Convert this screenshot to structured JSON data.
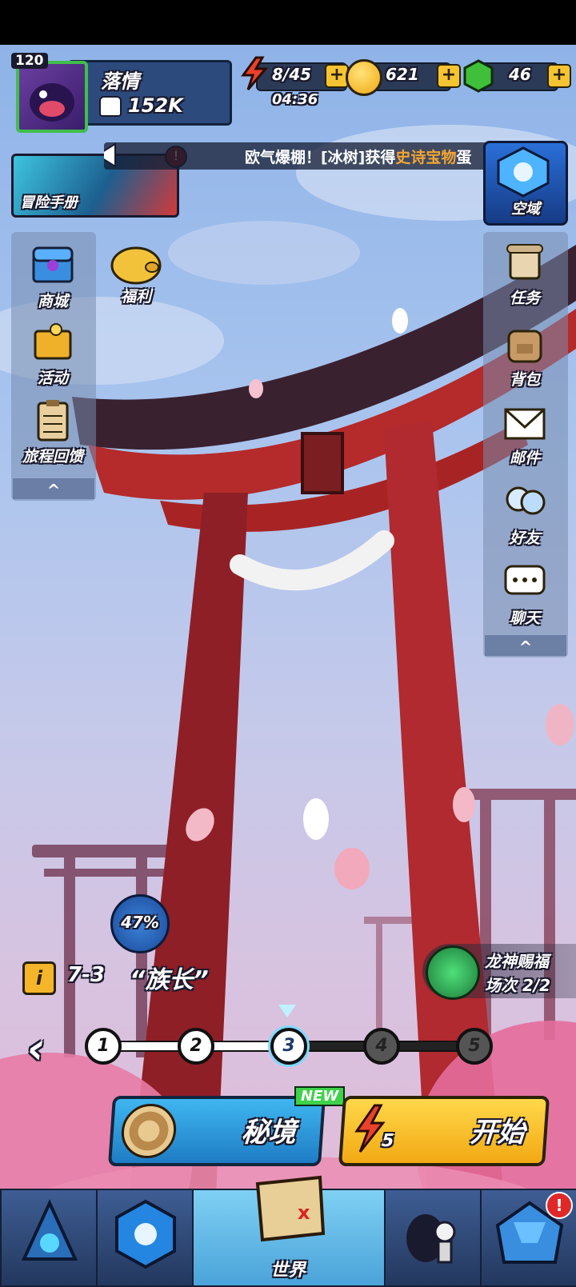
{
  "player": {
    "level": "120",
    "name": "落情",
    "power": "152K"
  },
  "resources": {
    "energy": "8/45",
    "energy_timer": "04:36",
    "coins": "621",
    "gems": "46",
    "plus": "+"
  },
  "adventure_manual": {
    "label": "冒险手册"
  },
  "announcement": {
    "prefix": "欧气爆棚！[冰树]获得",
    "highlight": "史诗宝物",
    "suffix": "蛋"
  },
  "void_domain": {
    "label": "空域"
  },
  "left_menu": [
    {
      "label": "商城"
    },
    {
      "label": "活动"
    },
    {
      "label": "旅程回馈"
    }
  ],
  "welfare": {
    "label": "福利"
  },
  "right_menu": [
    {
      "label": "任务"
    },
    {
      "label": "背包"
    },
    {
      "label": "邮件"
    },
    {
      "label": "好友"
    },
    {
      "label": "聊天"
    }
  ],
  "collapse": "^",
  "progress": {
    "percent_text": "47%",
    "value": 0.47
  },
  "stage": {
    "info_icon": "i",
    "code": "7-3",
    "title": "“族长”"
  },
  "dragon_blessing": {
    "title": "龙神赐福",
    "count": "场次 2/2"
  },
  "stage_nodes": [
    "1",
    "2",
    "3",
    "4",
    "5"
  ],
  "current_node": 3,
  "back_arrow": "‹",
  "secret_realm": {
    "label": "秘境",
    "badge": "NEW"
  },
  "start": {
    "label": "开始",
    "cost": "5"
  },
  "bottom_nav": [
    {
      "icon": "heroes-icon"
    },
    {
      "icon": "rune-icon"
    },
    {
      "icon": "map-icon",
      "label": "世界"
    },
    {
      "icon": "monsters-icon"
    },
    {
      "icon": "home-icon",
      "badge": "!"
    }
  ],
  "colors": {
    "torii_red": "#b52a2a",
    "accent_yellow": "#f5c431",
    "sky": "#a8c4ee"
  }
}
